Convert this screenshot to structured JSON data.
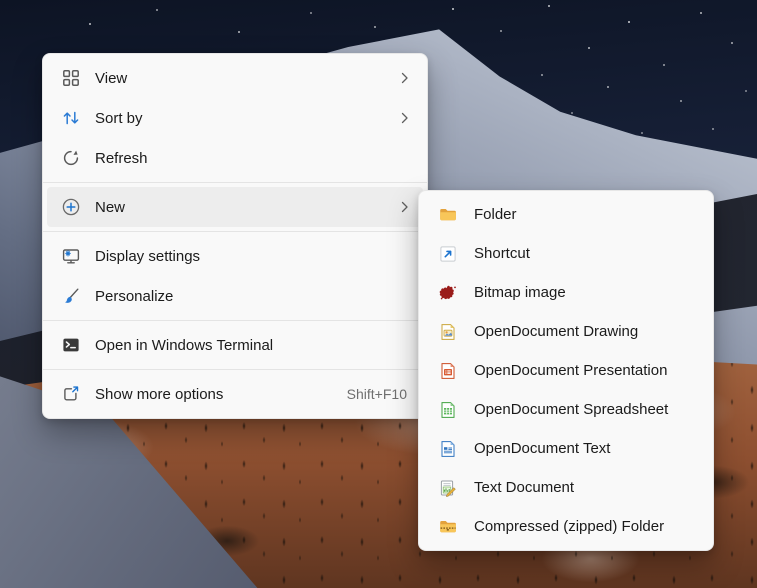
{
  "context_menu": {
    "items": [
      {
        "label": "View",
        "icon": "view-grid-icon",
        "has_submenu": true
      },
      {
        "label": "Sort by",
        "icon": "sort-arrows-icon",
        "has_submenu": true
      },
      {
        "label": "Refresh",
        "icon": "refresh-icon",
        "has_submenu": false
      },
      {
        "label": "New",
        "icon": "new-plus-circle-icon",
        "has_submenu": true,
        "state": "highlighted"
      },
      {
        "label": "Display settings",
        "icon": "display-settings-icon",
        "has_submenu": false
      },
      {
        "label": "Personalize",
        "icon": "paintbrush-icon",
        "has_submenu": false
      },
      {
        "label": "Open in Windows Terminal",
        "icon": "windows-terminal-icon",
        "has_submenu": false
      },
      {
        "label": "Show more options",
        "icon": "show-more-options-icon",
        "shortcut": "Shift+F10",
        "has_submenu": false
      }
    ]
  },
  "new_submenu": {
    "items": [
      {
        "label": "Folder",
        "icon": "folder-icon"
      },
      {
        "label": "Shortcut",
        "icon": "shortcut-arrow-icon"
      },
      {
        "label": "Bitmap image",
        "icon": "bitmap-splat-icon"
      },
      {
        "label": "OpenDocument Drawing",
        "icon": "opendocument-drawing-icon"
      },
      {
        "label": "OpenDocument Presentation",
        "icon": "opendocument-presentation-icon"
      },
      {
        "label": "OpenDocument Spreadsheet",
        "icon": "opendocument-spreadsheet-icon"
      },
      {
        "label": "OpenDocument Text",
        "icon": "opendocument-text-icon"
      },
      {
        "label": "Text Document",
        "icon": "text-document-icon"
      },
      {
        "label": "Compressed (zipped) Folder",
        "icon": "compressed-zip-folder-icon"
      }
    ]
  },
  "colors": {
    "accent": "#1d74cf",
    "menu_background": "#f9f9f9",
    "menu_highlight": "#ededed",
    "label_text": "#1b1b1b",
    "shortcut_text": "#6f6f6f",
    "sky": "#151e34",
    "snow": "#aab2c2",
    "ground": "#96583a"
  }
}
